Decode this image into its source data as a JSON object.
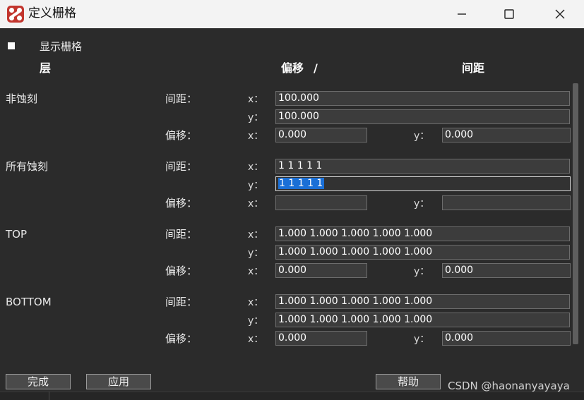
{
  "window": {
    "title": "定义栅格"
  },
  "show_grid": {
    "label": "显示栅格",
    "checked": true
  },
  "headers": {
    "layer": "层",
    "offset": "偏移",
    "slash": "/",
    "spacing": "间距"
  },
  "labels": {
    "spacing": "间距：",
    "offset": "偏移：",
    "x": "x：",
    "y": "y："
  },
  "layers": [
    {
      "name": "非蚀刻",
      "spacing_x": "100.000",
      "spacing_y": "100.000",
      "offset_x": "0.000",
      "offset_y": "0.000"
    },
    {
      "name": "所有蚀刻",
      "spacing_x": "1 1 1 1 1",
      "spacing_y": "1 1 1 1 1",
      "offset_x": "",
      "offset_y": ""
    },
    {
      "name": "TOP",
      "spacing_x": "1.000 1.000 1.000 1.000 1.000",
      "spacing_y": "1.000 1.000 1.000 1.000 1.000",
      "offset_x": "0.000",
      "offset_y": "0.000"
    },
    {
      "name": "BOTTOM",
      "spacing_x": "1.000 1.000 1.000 1.000 1.000",
      "spacing_y": "1.000 1.000 1.000 1.000 1.000",
      "offset_x": "0.000",
      "offset_y": "0.000"
    }
  ],
  "buttons": {
    "done": "完成",
    "apply": "应用",
    "help": "帮助"
  },
  "watermark": "CSDN @haonanyayaya",
  "colors": {
    "selection": "#1a6fd6",
    "app_icon": "#c2362e"
  }
}
